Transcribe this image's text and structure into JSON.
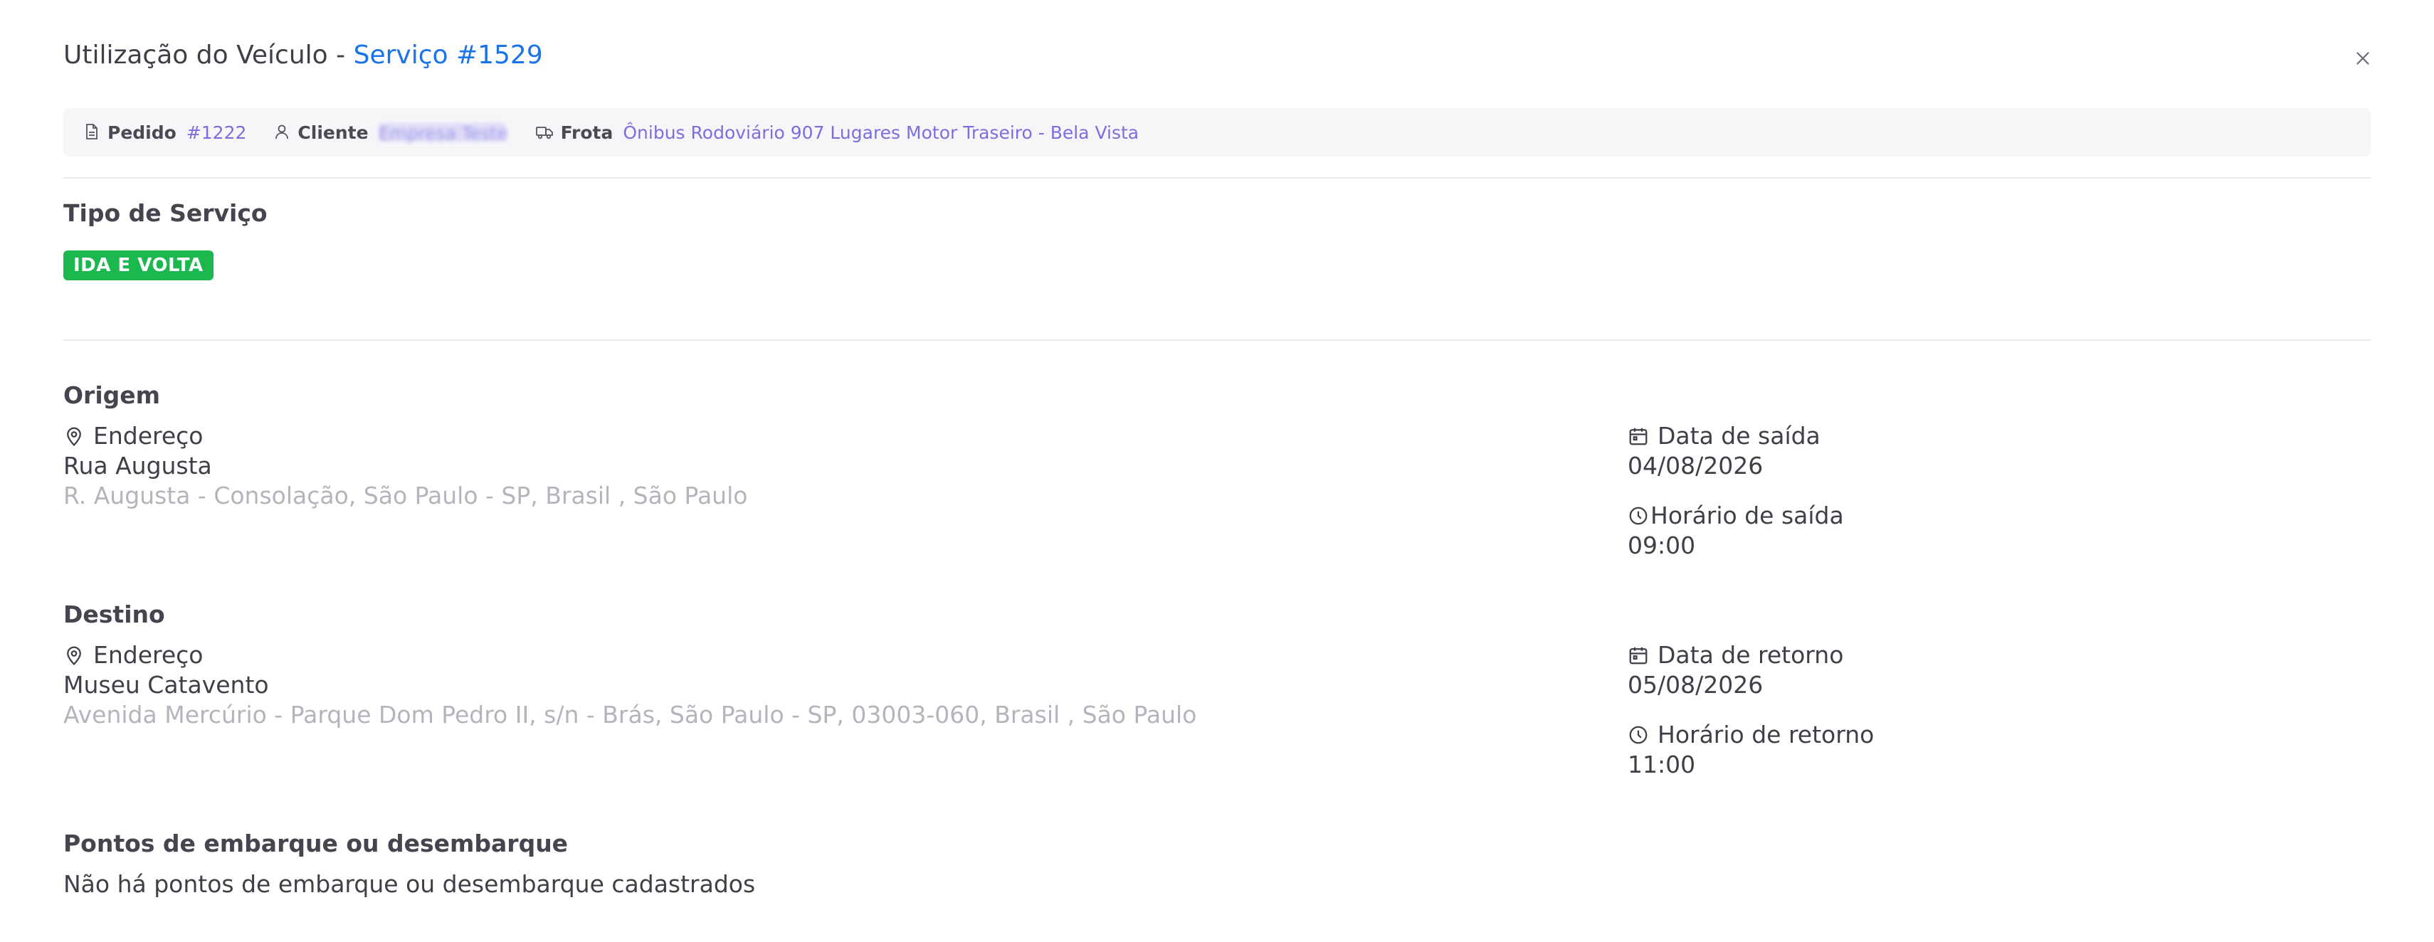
{
  "header": {
    "title": "Utilização do Veículo",
    "separator": " - ",
    "service": "Serviço #1529"
  },
  "infobar": {
    "pedido_label": "Pedido",
    "pedido_value": "#1222",
    "cliente_label": "Cliente",
    "cliente_value": "Empresa Teste",
    "frota_label": "Frota",
    "frota_value": "Ônibus Rodoviário 907 Lugares Motor Traseiro - Bela Vista"
  },
  "tipo_servico": {
    "title": "Tipo de Serviço",
    "badge": "IDA E VOLTA"
  },
  "origem": {
    "title": "Origem",
    "address_label": "Endereço",
    "place": "Rua Augusta",
    "full_address": "R. Augusta - Consolação, São Paulo - SP, Brasil , São Paulo",
    "date_label": "Data de saída",
    "date_value": "04/08/2026",
    "time_label": "Horário de saída",
    "time_value": "09:00"
  },
  "destino": {
    "title": "Destino",
    "address_label": "Endereço",
    "place": "Museu Catavento",
    "full_address": "Avenida Mercúrio - Parque Dom Pedro II, s/n - Brás, São Paulo - SP, 03003-060, Brasil , São Paulo",
    "date_label": "Data de retorno",
    "date_value": "05/08/2026",
    "time_label": "Horário de retorno",
    "time_value": "11:00"
  },
  "pontos": {
    "title": "Pontos de embarque ou desembarque",
    "empty_text": "Não há pontos de embarque ou desembarque cadastrados"
  },
  "colors": {
    "accent_blue": "#1a73e8",
    "link_purple": "#7b6fe0",
    "badge_green": "#1ab84e"
  },
  "icons": {
    "close": "close-icon",
    "pedido": "document-icon",
    "cliente": "user-icon",
    "frota": "truck-icon",
    "endereco": "map-pin-icon",
    "data": "calendar-icon",
    "horario": "clock-icon"
  }
}
